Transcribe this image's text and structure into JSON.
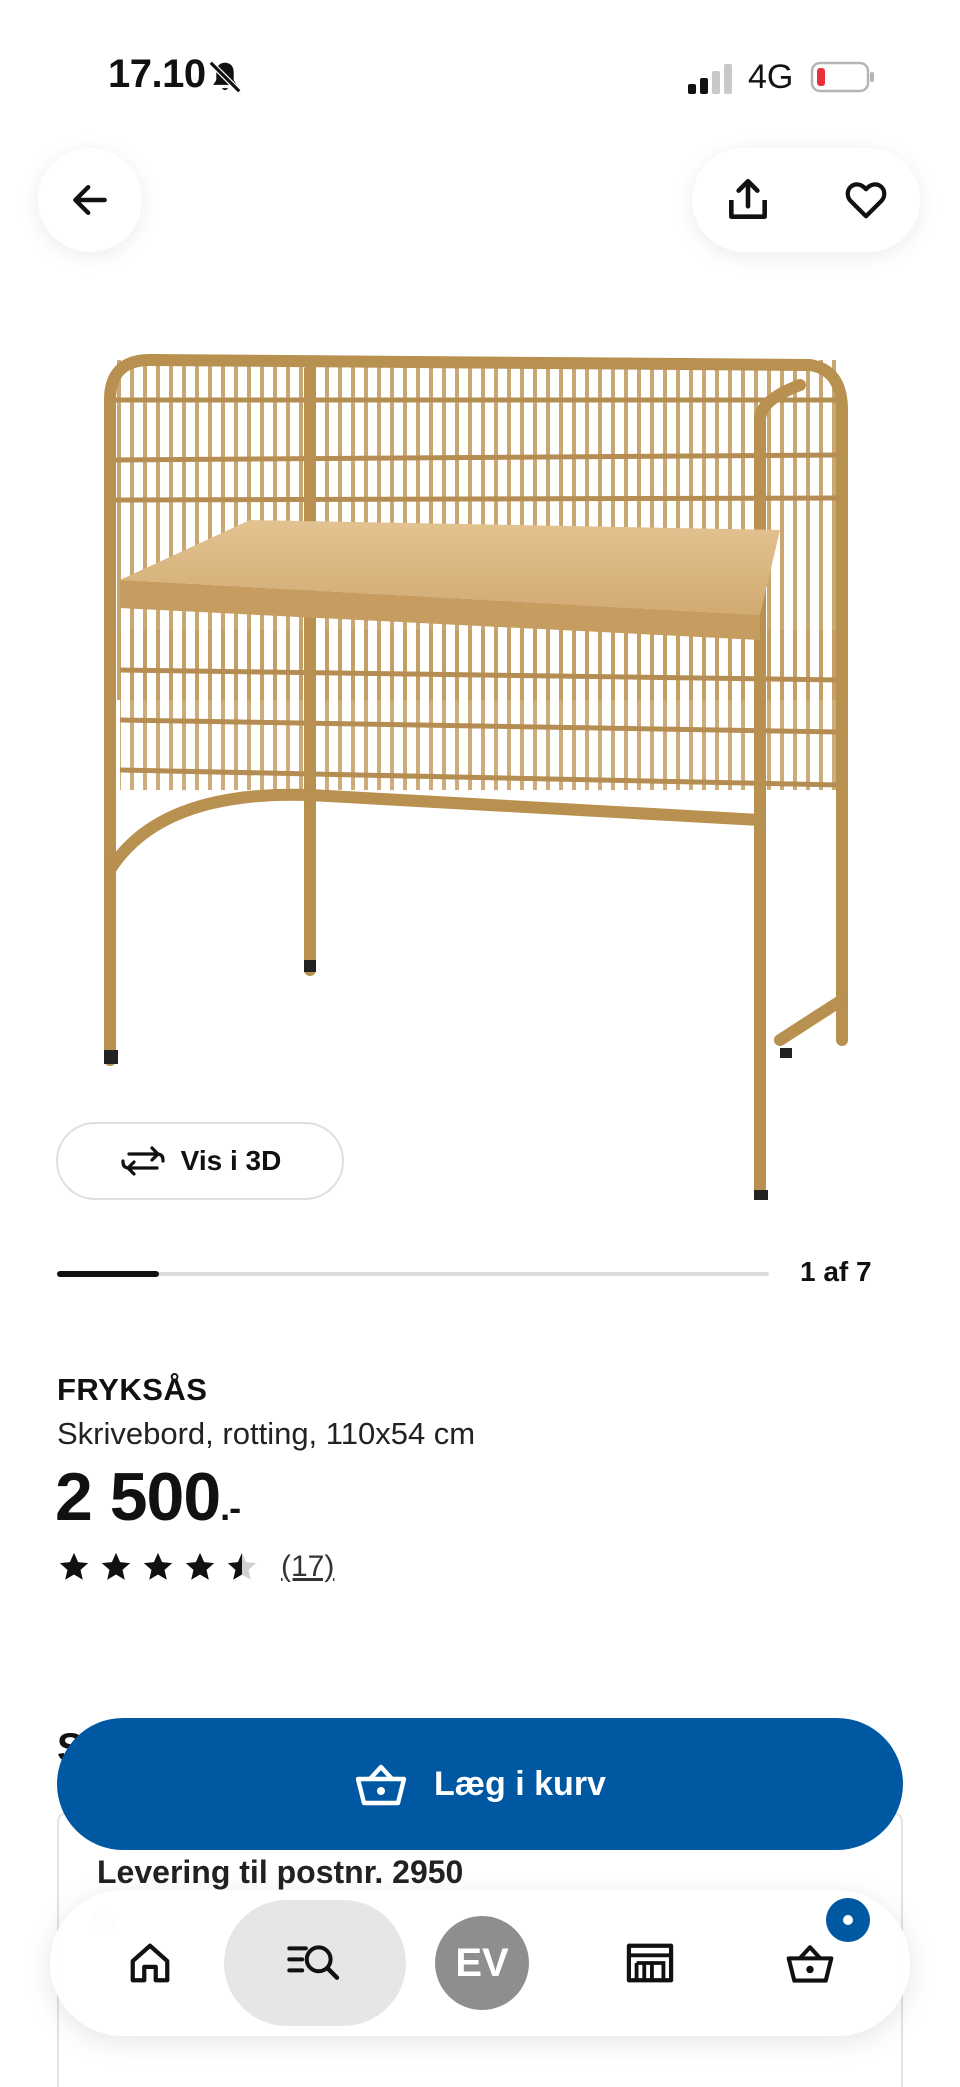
{
  "status_bar": {
    "time": "17.10",
    "network": "4G"
  },
  "gallery": {
    "view_3d_label": "Vis i 3D",
    "counter": "1 af 7",
    "progress": 0.143
  },
  "product": {
    "brand": "FRYKSÅS",
    "description": "Skrivebord, rotting, 110x54 cm",
    "price": "2 500",
    "price_suffix": ".-",
    "rating": 4.5,
    "review_count": "(17)"
  },
  "section": {
    "heading_partial": "S"
  },
  "delivery": {
    "title": "Levering til postnr. 2950"
  },
  "cart": {
    "label": "Læg i kurv"
  },
  "nav": {
    "profile_initials": "EV"
  },
  "colors": {
    "primary": "#0058a3",
    "rattan": "#c9a46a",
    "wood": "#d9b57e"
  },
  "icons": [
    "back-arrow-icon",
    "share-icon",
    "heart-icon",
    "rotate-3d-icon",
    "star-icon",
    "basket-icon",
    "home-icon",
    "search-list-icon",
    "store-icon"
  ]
}
